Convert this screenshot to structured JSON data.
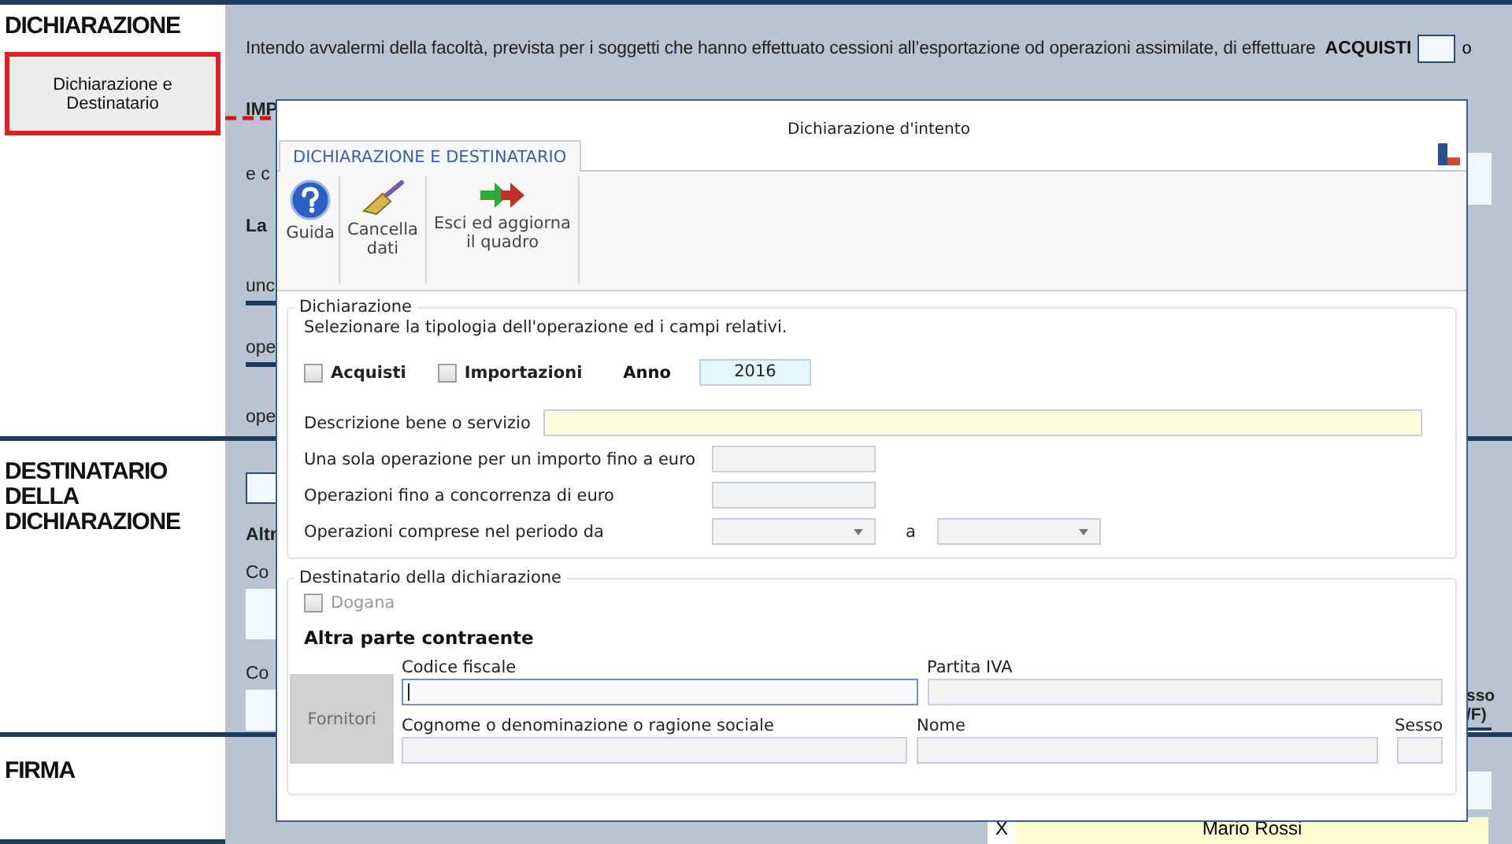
{
  "sections": [
    {
      "title": "DICHIARAZIONE"
    },
    {
      "title": "DESTINATARIO DELLA DICHIARAZIONE"
    },
    {
      "title": "FIRMA"
    }
  ],
  "highlighted_button": {
    "label": "Dichiarazione e Destinatario"
  },
  "background_form": {
    "intro": "Intendo avvalermi della facoltà, prevista per i soggetti che hanno effettuato cessioni all’esportazione od operazioni assimilate, di effettuare",
    "acquisti_label": "ACQUISTI",
    "or_text": "o",
    "fragments_top": [
      {
        "text": "IMP",
        "kind": "bold"
      },
      {
        "text": "e c",
        "kind": "plain"
      },
      {
        "text": "La",
        "kind": "bold"
      },
      {
        "text": "unc",
        "kind": "underlined"
      },
      {
        "text": "ope",
        "kind": "underlined"
      },
      {
        "text": "ope",
        "kind": "plain"
      }
    ],
    "fragments_middle": [
      {
        "text": "Altr",
        "kind": "bold"
      },
      {
        "text": "Co",
        "kind": "plain"
      },
      {
        "text": "Co",
        "kind": "plain"
      }
    ],
    "sesso_fragment": [
      "sso",
      "/F)"
    ],
    "signature_row": {
      "mark": "X",
      "name": "Mario Rossi"
    }
  },
  "dialog": {
    "title": "Dichiarazione d'intento",
    "tabs": [
      {
        "label": "DICHIARAZIONE E DESTINATARIO",
        "selected": true
      }
    ],
    "toolbar": [
      {
        "label": "Guida",
        "kind": "help"
      },
      {
        "label": "Cancella dati",
        "kind": "brush"
      },
      {
        "label": "Esci ed aggiorna il quadro",
        "kind": "exit"
      }
    ],
    "dichiarazione": {
      "legend": "Dichiarazione",
      "hint": "Selezionare la tipologia dell'operazione ed i campi relativi.",
      "checkboxes": [
        {
          "label": "Acquisti",
          "checked": false
        },
        {
          "label": "Importazioni",
          "checked": false
        }
      ],
      "year": {
        "label": "Anno",
        "value": "2016"
      },
      "fields": [
        {
          "label": "Descrizione bene o servizio",
          "kind": "wide"
        },
        {
          "label": "Una sola operazione per un importo fino a euro",
          "kind": "amount"
        },
        {
          "label": "Operazioni fino a concorrenza di euro",
          "kind": "amount"
        },
        {
          "label": "Operazioni comprese nel periodo da",
          "kind": "period",
          "to_label": "a"
        }
      ]
    },
    "destinatario": {
      "legend": "Destinatario della dichiarazione",
      "dogana": {
        "label": "Dogana",
        "checked": false,
        "disabled": true
      },
      "subtitle": "Altra parte contraente",
      "fornitori": {
        "label": "Fornitori",
        "disabled": true
      },
      "rows": [
        [
          {
            "label": "Codice fiscale",
            "kind": "wide",
            "focused": true
          },
          {
            "label": "Partita IVA",
            "kind": "wide",
            "focused": false
          }
        ],
        [
          {
            "label": "Cognome o denominazione o ragione sociale",
            "kind": "wide",
            "focused": false
          },
          {
            "label": "Nome",
            "kind": "medium",
            "focused": false
          },
          {
            "label": "Sesso",
            "kind": "narrow",
            "focused": false
          }
        ]
      ]
    }
  }
}
